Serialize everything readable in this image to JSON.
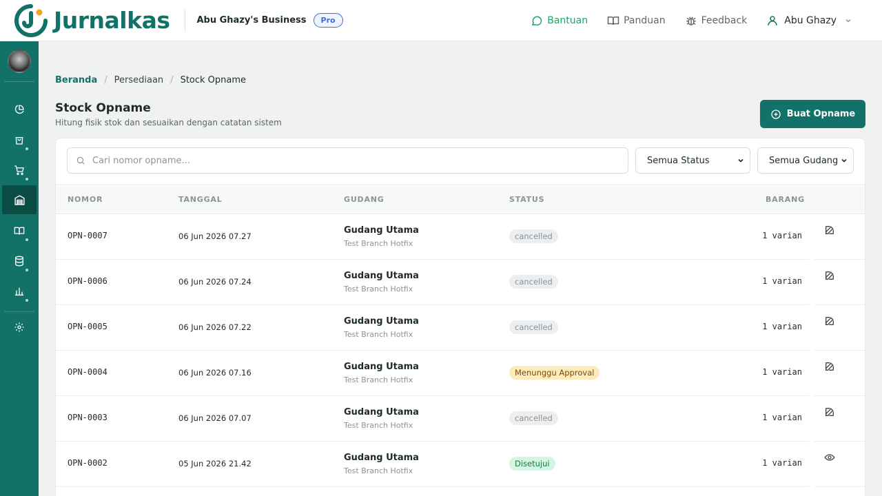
{
  "header": {
    "brand": "Jurnalkas",
    "business": "Abu Ghazy's Business",
    "plan_badge": "Pro",
    "nav": [
      {
        "label": "Bantuan",
        "icon": "chat-bubble-icon"
      },
      {
        "label": "Panduan",
        "icon": "book-open-icon"
      },
      {
        "label": "Feedback",
        "icon": "bug-icon"
      }
    ],
    "user_name": "Abu Ghazy"
  },
  "sidebar": {
    "items": [
      {
        "name": "dashboard",
        "icon": "pie-chart-icon"
      },
      {
        "name": "sales",
        "icon": "shopping-bag-icon"
      },
      {
        "name": "purchases",
        "icon": "cart-icon"
      },
      {
        "name": "inventory",
        "icon": "warehouse-icon",
        "active": true
      },
      {
        "name": "accounting",
        "icon": "book-icon"
      },
      {
        "name": "data",
        "icon": "database-icon"
      },
      {
        "name": "reports",
        "icon": "bar-chart-icon"
      },
      {
        "name": "settings",
        "icon": "gear-icon"
      }
    ]
  },
  "breadcrumb": {
    "home": "Beranda",
    "section": "Persediaan",
    "current": "Stock Opname"
  },
  "page": {
    "title": "Stock Opname",
    "subtitle": "Hitung fisik stok dan sesuaikan dengan catatan sistem",
    "create_button": "Buat Opname"
  },
  "filters": {
    "search_placeholder": "Cari nomor opname...",
    "status_selected": "Semua Status",
    "gudang_selected": "Semua Gudang"
  },
  "table": {
    "columns": [
      "NOMOR",
      "TANGGAL",
      "GUDANG",
      "STATUS",
      "BARANG"
    ],
    "rows": [
      {
        "nomor": "OPN-0007",
        "tanggal": "06 Jun 2026 07.27",
        "gudang": "Gudang Utama",
        "branch": "Test Branch Hotfix",
        "status": "cancelled",
        "status_kind": "cancel",
        "barang": "1 varian",
        "action": "edit"
      },
      {
        "nomor": "OPN-0006",
        "tanggal": "06 Jun 2026 07.24",
        "gudang": "Gudang Utama",
        "branch": "Test Branch Hotfix",
        "status": "cancelled",
        "status_kind": "cancel",
        "barang": "1 varian",
        "action": "edit"
      },
      {
        "nomor": "OPN-0005",
        "tanggal": "06 Jun 2026 07.22",
        "gudang": "Gudang Utama",
        "branch": "Test Branch Hotfix",
        "status": "cancelled",
        "status_kind": "cancel",
        "barang": "1 varian",
        "action": "edit"
      },
      {
        "nomor": "OPN-0004",
        "tanggal": "06 Jun 2026 07.16",
        "gudang": "Gudang Utama",
        "branch": "Test Branch Hotfix",
        "status": "Menunggu Approval",
        "status_kind": "wait",
        "barang": "1 varian",
        "action": "edit"
      },
      {
        "nomor": "OPN-0003",
        "tanggal": "06 Jun 2026 07.07",
        "gudang": "Gudang Utama",
        "branch": "Test Branch Hotfix",
        "status": "cancelled",
        "status_kind": "cancel",
        "barang": "1 varian",
        "action": "edit"
      },
      {
        "nomor": "OPN-0002",
        "tanggal": "05 Jun 2026 21.42",
        "gudang": "Gudang Utama",
        "branch": "Test Branch Hotfix",
        "status": "Disetujui",
        "status_kind": "ok",
        "barang": "1 varian",
        "action": "view"
      }
    ]
  },
  "colors": {
    "brand": "#137267",
    "accent_green": "#19a866",
    "pro_blue": "#3b6fd3"
  }
}
